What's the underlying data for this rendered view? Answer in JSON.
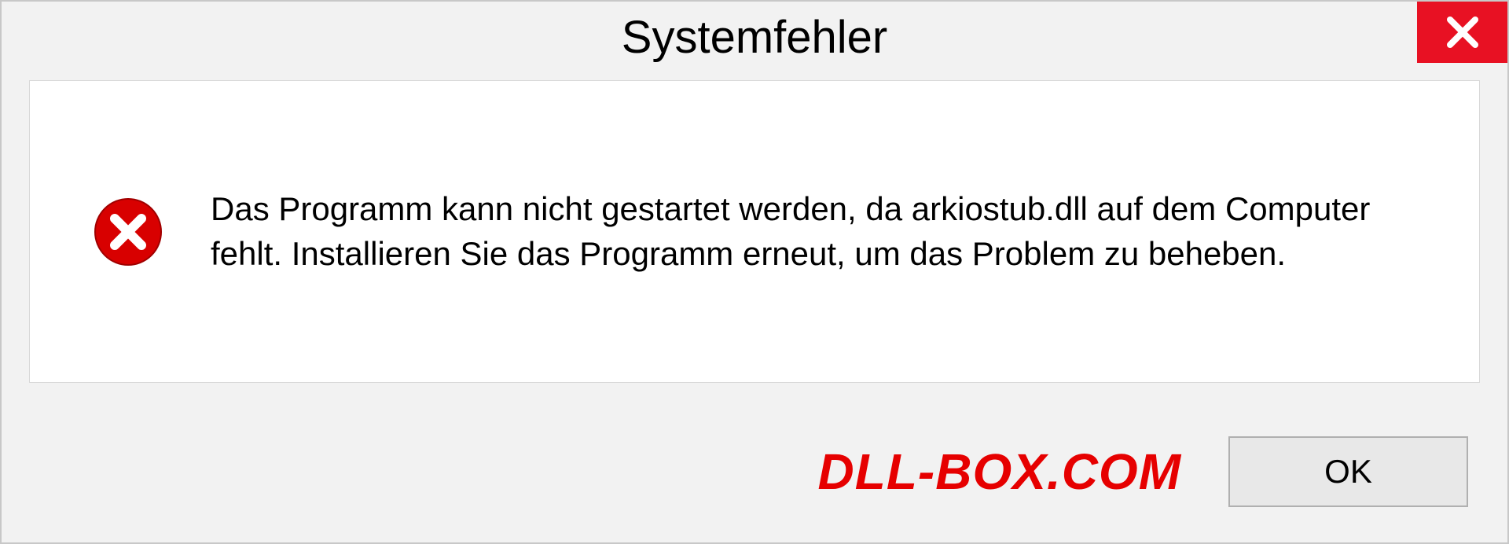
{
  "dialog": {
    "title": "Systemfehler",
    "message": "Das Programm kann nicht gestartet werden, da arkiostub.dll auf dem Computer fehlt. Installieren Sie das Programm erneut, um das Problem zu beheben.",
    "ok_label": "OK"
  },
  "watermark": "DLL-BOX.COM"
}
